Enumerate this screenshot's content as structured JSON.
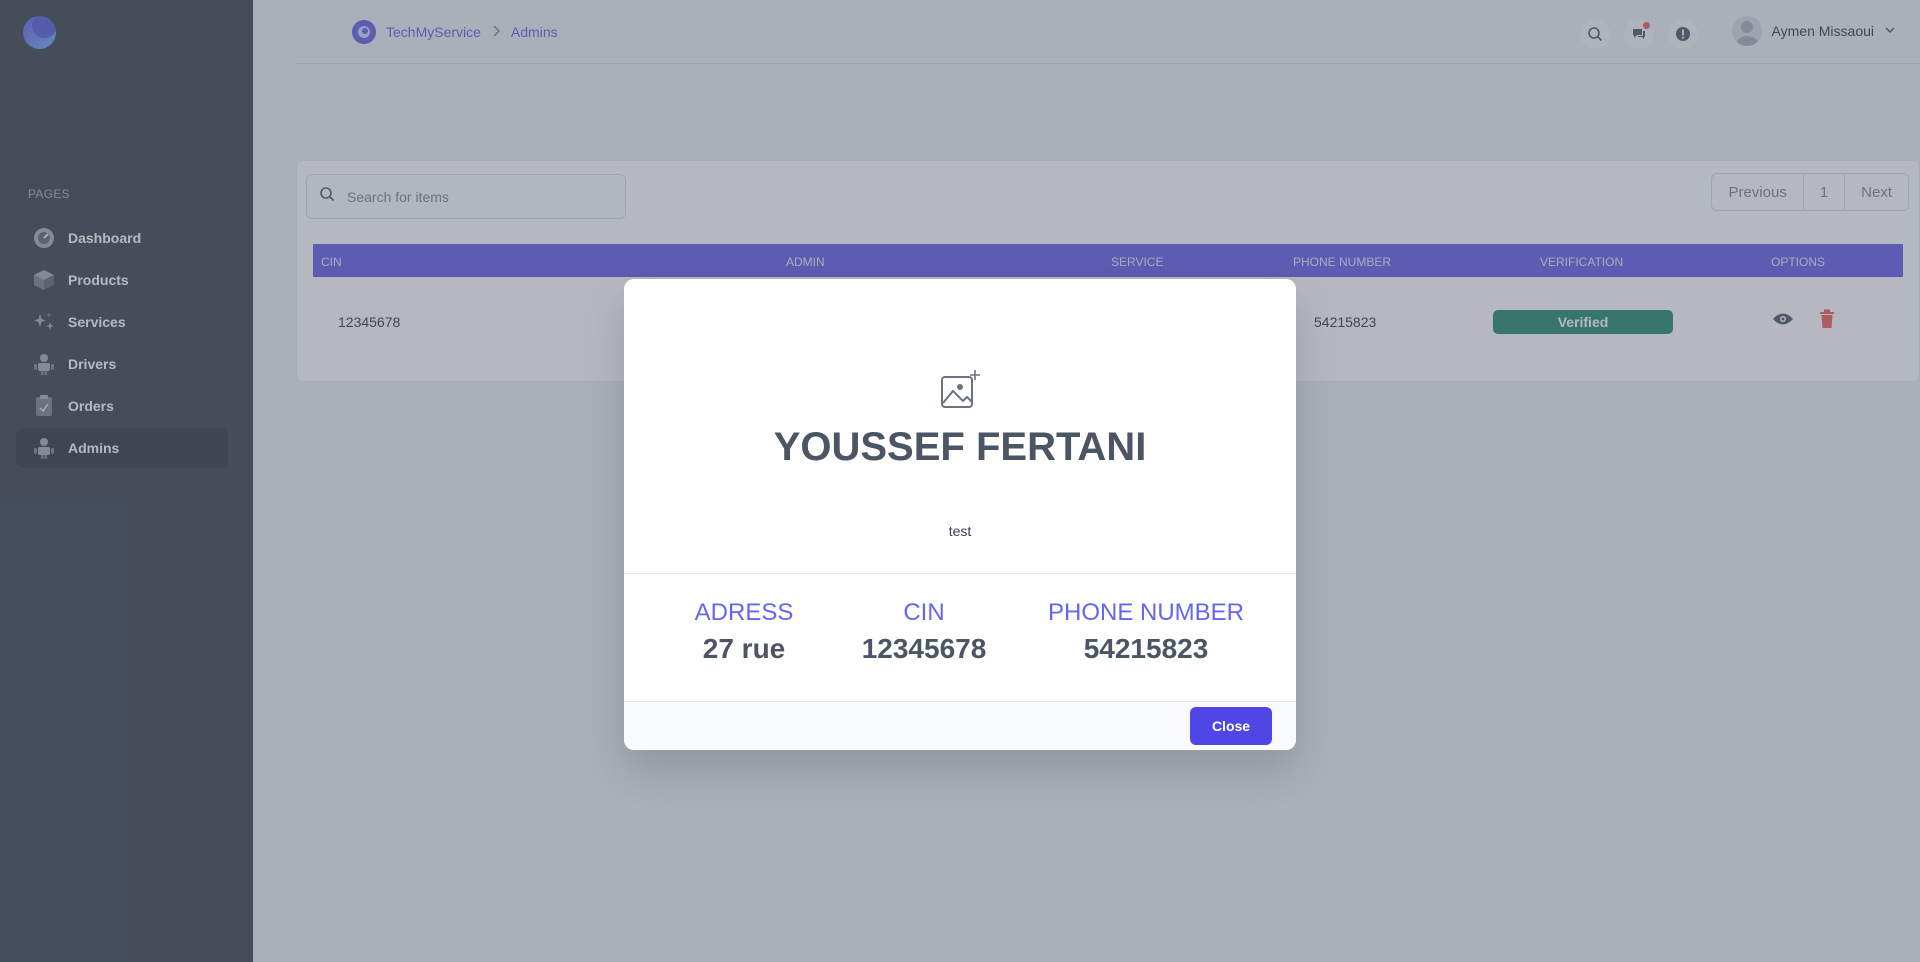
{
  "sidebar": {
    "section_label": "PAGES",
    "items": [
      {
        "label": "Dashboard",
        "icon": "dashboard-icon"
      },
      {
        "label": "Products",
        "icon": "box-icon"
      },
      {
        "label": "Services",
        "icon": "sparkles-icon"
      },
      {
        "label": "Drivers",
        "icon": "users-icon"
      },
      {
        "label": "Orders",
        "icon": "clipboard-icon"
      },
      {
        "label": "Admins",
        "icon": "users-icon",
        "active": true
      }
    ]
  },
  "topbar": {
    "breadcrumb": {
      "root": "TechMyService",
      "current": "Admins"
    },
    "user_name": "Aymen Missaoui"
  },
  "table": {
    "search_placeholder": "Search for items",
    "pagination": {
      "previous": "Previous",
      "page": "1",
      "next": "Next"
    },
    "columns": [
      "CIN",
      "ADMIN",
      "SERVICE",
      "PHONE NUMBER",
      "VERIFICATION",
      "OPTIONS"
    ],
    "row": {
      "cin": "12345678",
      "phone": "54215823",
      "verification": "Verified"
    }
  },
  "modal": {
    "name": "YOUSSEF FERTANI",
    "subtitle": "test",
    "stats": [
      {
        "label": "ADRESS",
        "value": "27 rue"
      },
      {
        "label": "CIN",
        "value": "12345678"
      },
      {
        "label": "PHONE NUMBER",
        "value": "54215823"
      }
    ],
    "close_label": "Close"
  },
  "colors": {
    "sidebar": "#1f2937",
    "accent": "#4f46e5",
    "verified": "#047857",
    "stat_label": "#6366f1",
    "danger": "#ef4444"
  }
}
